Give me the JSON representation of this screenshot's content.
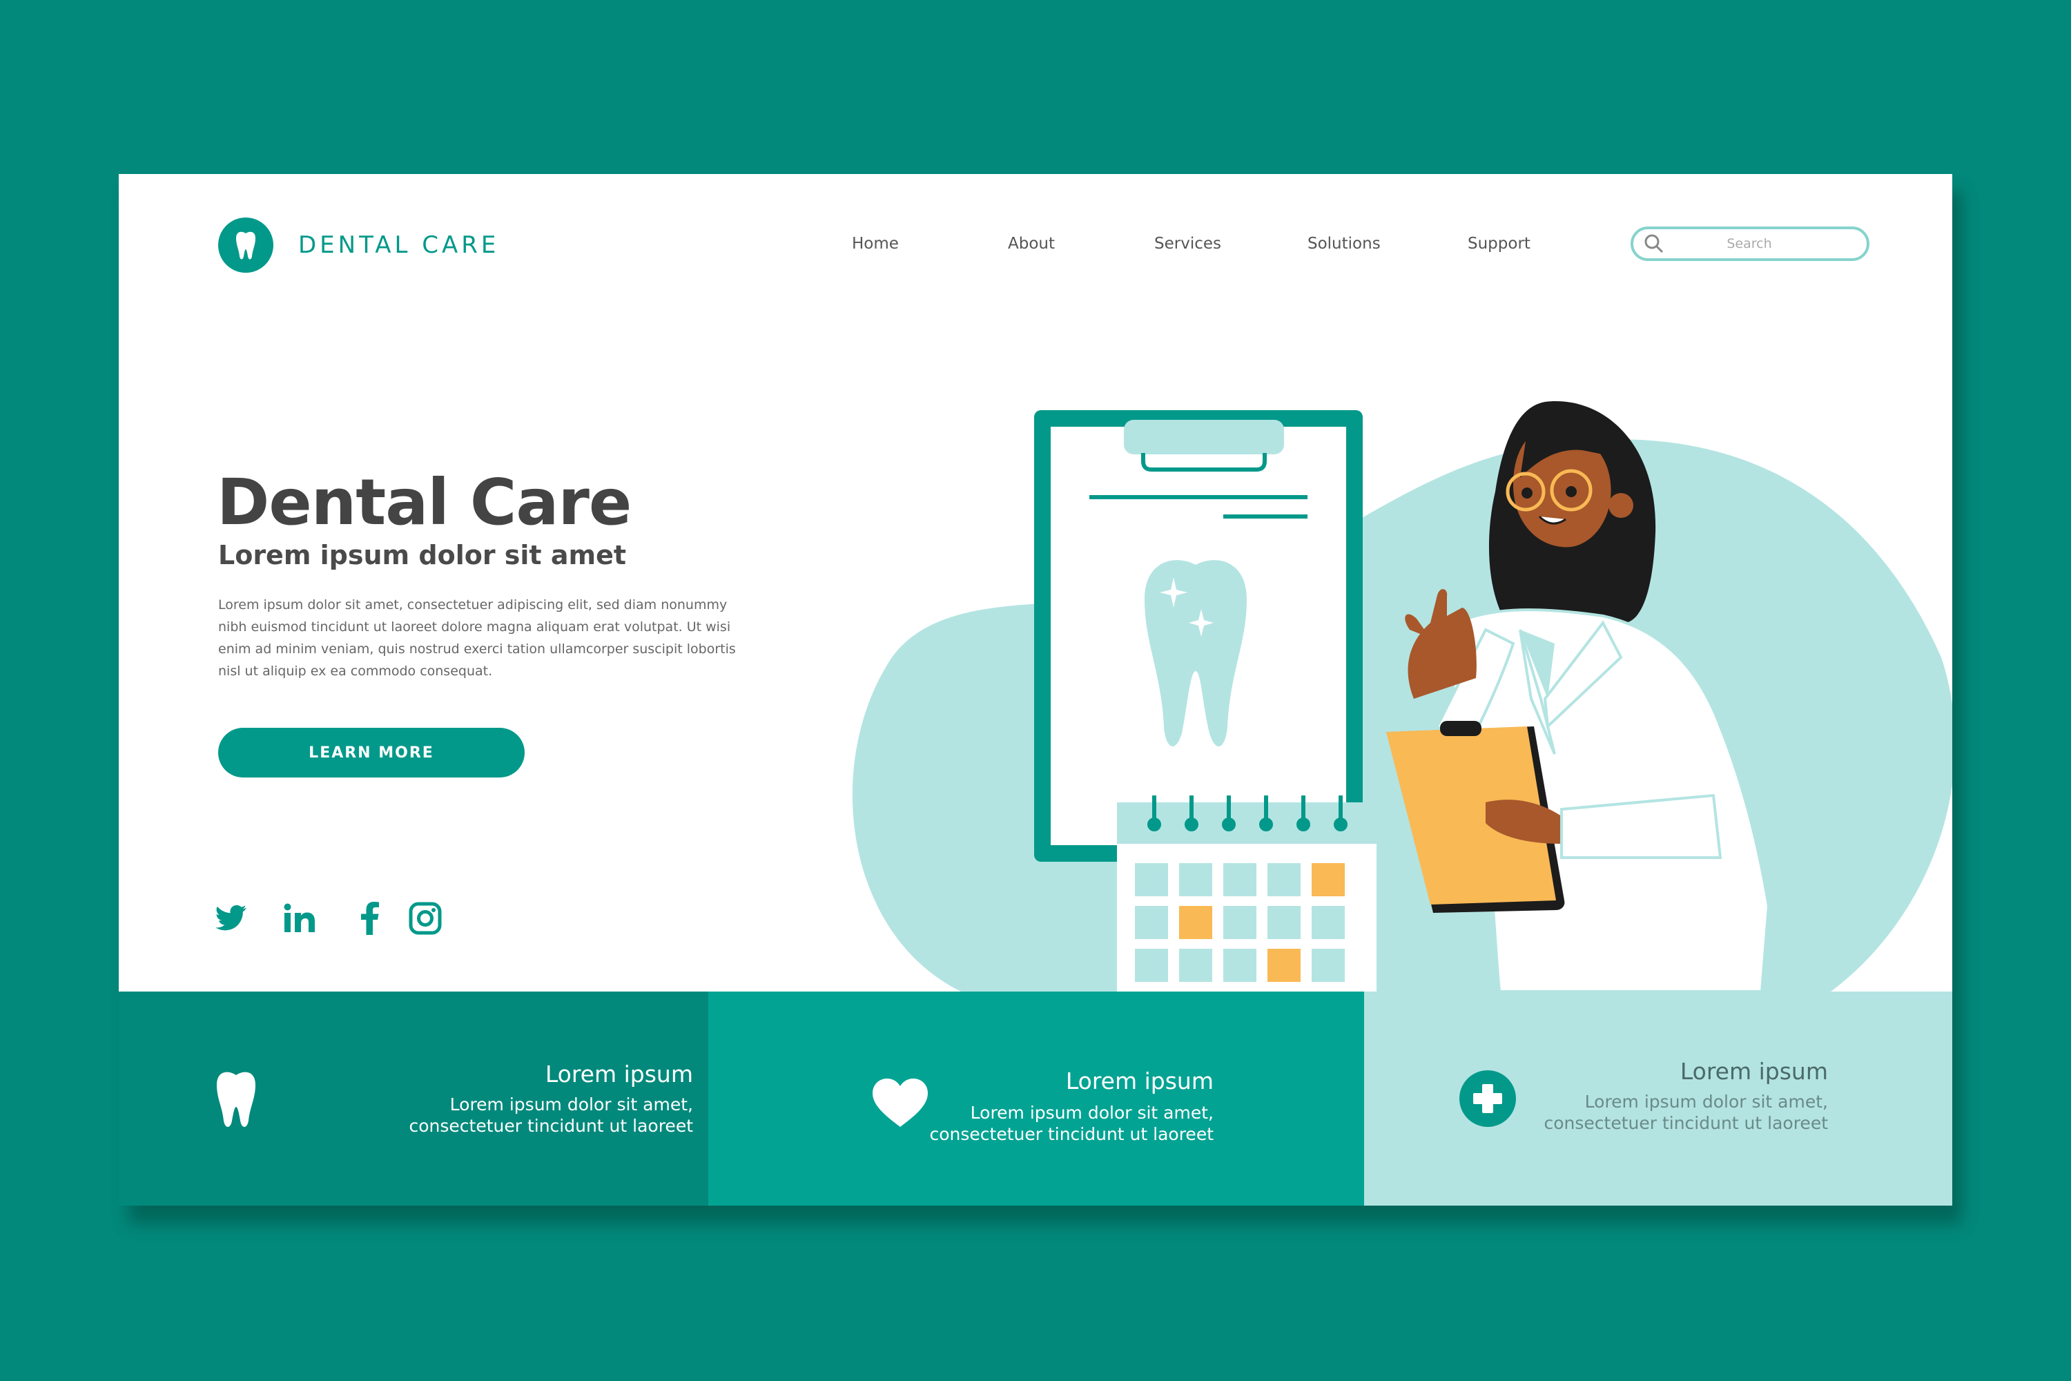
{
  "brand": {
    "name": "DENTAL CARE",
    "primary_color": "#03998a",
    "dark_color": "#02897b",
    "light_color": "#b3e4e2",
    "accent_color": "#f9b955"
  },
  "nav": {
    "items": [
      {
        "label": "Home"
      },
      {
        "label": "About"
      },
      {
        "label": "Services"
      },
      {
        "label": "Solutions"
      },
      {
        "label": "Support"
      }
    ]
  },
  "search": {
    "placeholder": "Search"
  },
  "hero": {
    "title": "Dental Care",
    "subtitle": "Lorem ipsum dolor sit amet",
    "body": "Lorem ipsum dolor sit amet, consectetuer adipiscing elit, sed diam nonummy nibh euismod tincidunt ut laoreet dolore magna aliquam erat volutpat. Ut wisi enim ad minim veniam, quis nostrud exerci tation ullamcorper suscipit lobortis nisl ut aliquip ex ea commodo consequat.",
    "cta_label": "LEARN MORE"
  },
  "social": [
    "twitter-icon",
    "linkedin-icon",
    "facebook-icon",
    "instagram-icon"
  ],
  "features": [
    {
      "icon": "tooth-icon",
      "title": "Lorem ipsum",
      "line1": "Lorem ipsum dolor sit amet,",
      "line2": "consectetuer tincidunt ut laoreet",
      "bg": "#02897b"
    },
    {
      "icon": "heart-icon",
      "title": "Lorem ipsum",
      "line1": "Lorem ipsum dolor sit amet,",
      "line2": "consectetuer tincidunt ut laoreet",
      "bg": "#03a393"
    },
    {
      "icon": "medical-cross-icon",
      "title": "Lorem ipsum",
      "line1": "Lorem ipsum dolor sit amet,",
      "line2": "consectetuer tincidunt ut laoreet",
      "bg": "#b3e4e2"
    }
  ]
}
